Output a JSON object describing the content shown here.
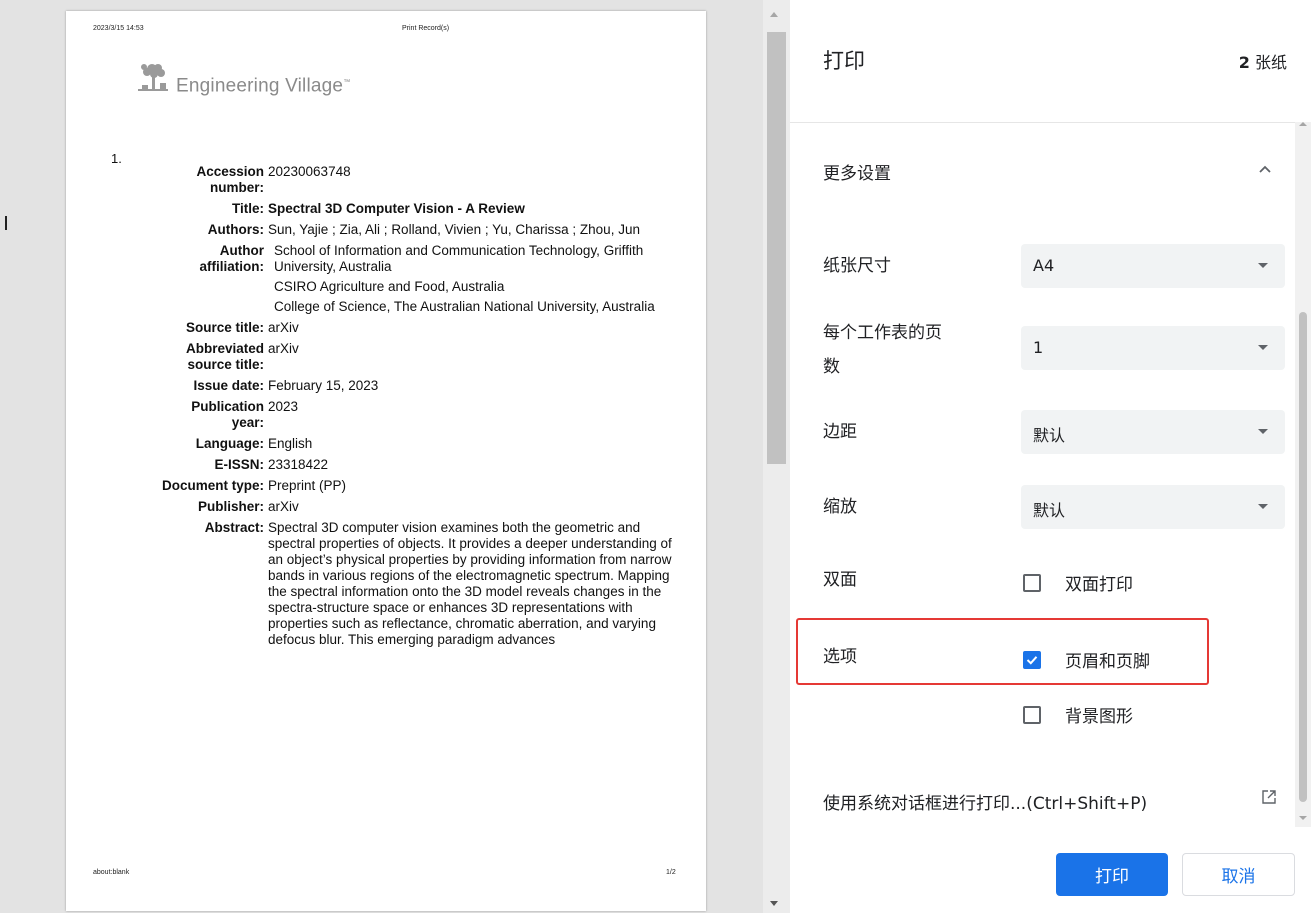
{
  "preview": {
    "header_date": "2023/3/15 14:53",
    "header_title": "Print Record(s)",
    "footer_left": "about:blank",
    "footer_right": "1/2",
    "logo_text": "Engineering Village",
    "logo_tm": "™",
    "record_number": "1.",
    "fields": [
      {
        "label": "Accession number:",
        "value": "20230063748"
      },
      {
        "label": "Title:",
        "value": "Spectral 3D Computer Vision - A Review"
      },
      {
        "label": "Authors:",
        "value": "Sun, Yajie ; Zia, Ali ; Rolland, Vivien ; Yu, Charissa ; Zhou, Jun"
      },
      {
        "label": "Author affiliation:",
        "values": [
          "School of Information and Communication Technology, Griffith University, Australia",
          "CSIRO Agriculture and Food, Australia",
          "College of Science, The Australian National University, Australia"
        ]
      },
      {
        "label": "Source title:",
        "value": "arXiv"
      },
      {
        "label": "Abbreviated source title:",
        "value": "arXiv"
      },
      {
        "label": "Issue date:",
        "value": "February 15, 2023"
      },
      {
        "label": "Publication year:",
        "value": "2023"
      },
      {
        "label": "Language:",
        "value": "English"
      },
      {
        "label": "E-ISSN:",
        "value": "23318422"
      },
      {
        "label": "Document type:",
        "value": "Preprint (PP)"
      },
      {
        "label": "Publisher:",
        "value": "arXiv"
      },
      {
        "label": "Abstract:",
        "value": "Spectral 3D computer vision examines both the geometric and spectral properties of objects. It provides a deeper understanding of an object’s physical properties by providing information from narrow bands in various regions of the electromagnetic spectrum. Mapping the spectral information onto the 3D model reveals changes in the spectra-structure space or enhances 3D representations with properties such as reflectance, chromatic aberration, and varying defocus blur. This emerging paradigm advances"
      }
    ]
  },
  "panel": {
    "title": "打印",
    "sheet_count_number": "2",
    "sheet_count_unit": "张纸",
    "more_settings": "更多设置",
    "paper_size_label": "纸张尺寸",
    "paper_size_value": "A4",
    "pages_per_sheet_label_line1": "每个工作表的页",
    "pages_per_sheet_label_line2": "数",
    "pages_per_sheet_value": "1",
    "margins_label": "边距",
    "margins_value": "默认",
    "scale_label": "缩放",
    "scale_value": "默认",
    "duplex_label": "双面",
    "duplex_option": "双面打印",
    "duplex_checked": false,
    "options_label": "选项",
    "headers_footers_option": "页眉和页脚",
    "headers_footers_checked": true,
    "background_graphics_option": "背景图形",
    "background_graphics_checked": false,
    "system_dialog_link": "使用系统对话框进行打印...(Ctrl+Shift+P)",
    "print_button": "打印",
    "cancel_button": "取消"
  },
  "colors": {
    "accent": "#1a73e8",
    "highlight_border": "#e53935",
    "preview_background": "#e3e3e3"
  },
  "icons": [
    "chevron-up-icon",
    "dropdown-arrow-icon",
    "checkbox-icon",
    "check-icon",
    "open-external-icon",
    "engineering-village-logo"
  ]
}
